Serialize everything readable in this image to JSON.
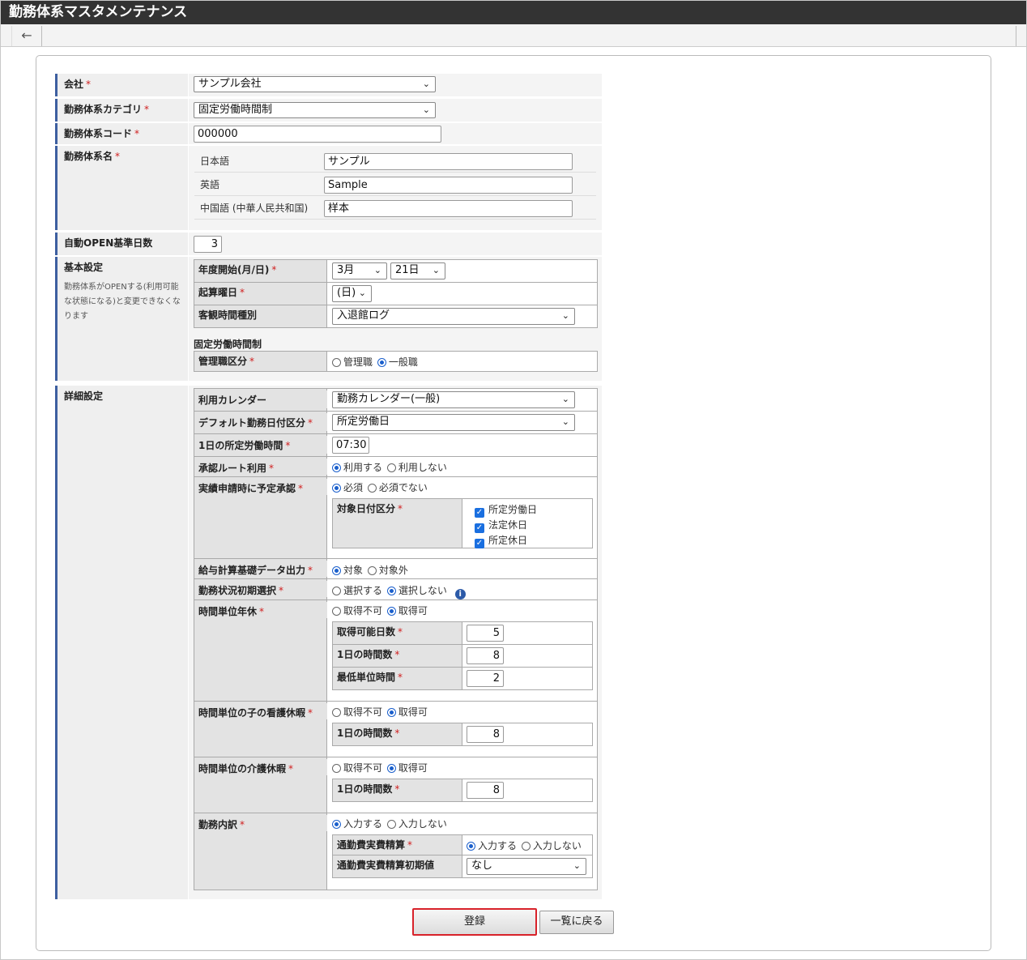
{
  "app": {
    "title": "勤務体系マスタメンテナンス",
    "back_icon": "←"
  },
  "form": {
    "company": {
      "label": "会社",
      "value": "サンプル会社"
    },
    "category": {
      "label": "勤務体系カテゴリ",
      "value": "固定労働時間制"
    },
    "code": {
      "label": "勤務体系コード",
      "value": "000000"
    },
    "name": {
      "label": "勤務体系名",
      "langs": [
        {
          "label": "日本語",
          "value": "サンプル"
        },
        {
          "label": "英語",
          "value": "Sample"
        },
        {
          "label": "中国語 (中華人民共和国)",
          "value": "样本"
        }
      ]
    },
    "auto_open": {
      "label": "自動OPEN基準日数",
      "value": "3"
    },
    "basic": {
      "label": "基本設定",
      "note": "勤務体系がOPENする(利用可能な状態になる)と変更できなくなります",
      "fiscal_start": {
        "label": "年度開始(月/日)",
        "month": "3月",
        "day": "21日"
      },
      "start_weekday": {
        "label": "起算曜日",
        "value": "(日)"
      },
      "objective_time": {
        "label": "客観時間種別",
        "value": "入退館ログ"
      },
      "section_title": "固定労働時間制",
      "manager_class": {
        "label": "管理職区分",
        "options": [
          "管理職",
          "一般職"
        ],
        "selected": 1
      }
    },
    "detail": {
      "label": "詳細設定",
      "calendar": {
        "label": "利用カレンダー",
        "value": "勤務カレンダー(一般)"
      },
      "default_date": {
        "label": "デフォルト勤務日付区分",
        "value": "所定労働日"
      },
      "daily_hours": {
        "label": "1日の所定労働時間",
        "value": "07:30"
      },
      "approval_route": {
        "label": "承認ルート利用",
        "options": [
          "利用する",
          "利用しない"
        ],
        "selected": 0
      },
      "plan_approval": {
        "label": "実績申請時に予定承認",
        "options": [
          "必須",
          "必須でない"
        ],
        "selected": 0,
        "target_label": "対象日付区分",
        "targets": [
          "所定労働日",
          "法定休日",
          "所定休日"
        ]
      },
      "payroll": {
        "label": "給与計算基礎データ出力",
        "options": [
          "対象",
          "対象外"
        ],
        "selected": 0
      },
      "status_initial": {
        "label": "勤務状況初期選択",
        "options": [
          "選択する",
          "選択しない"
        ],
        "selected": 1,
        "info_icon": "i"
      },
      "hourly_leave": {
        "label": "時間単位年休",
        "options": [
          "取得不可",
          "取得可"
        ],
        "selected": 1,
        "rows": [
          {
            "label": "取得可能日数",
            "value": "5"
          },
          {
            "label": "1日の時間数",
            "value": "8"
          },
          {
            "label": "最低単位時間",
            "value": "2"
          }
        ]
      },
      "child_care": {
        "label": "時間単位の子の看護休暇",
        "options": [
          "取得不可",
          "取得可"
        ],
        "selected": 1,
        "row": {
          "label": "1日の時間数",
          "value": "8"
        }
      },
      "nursing_care": {
        "label": "時間単位の介護休暇",
        "options": [
          "取得不可",
          "取得可"
        ],
        "selected": 1,
        "row": {
          "label": "1日の時間数",
          "value": "8"
        }
      },
      "breakdown": {
        "label": "勤務内訳",
        "options": [
          "入力する",
          "入力しない"
        ],
        "selected": 0,
        "commute": {
          "label": "通勤費実費精算",
          "options": [
            "入力する",
            "入力しない"
          ],
          "selected": 0
        },
        "commute_initial": {
          "label": "通勤費実費精算初期値",
          "value": "なし"
        }
      }
    }
  },
  "buttons": {
    "register": "登録",
    "back_to_list": "一覧に戻る"
  }
}
